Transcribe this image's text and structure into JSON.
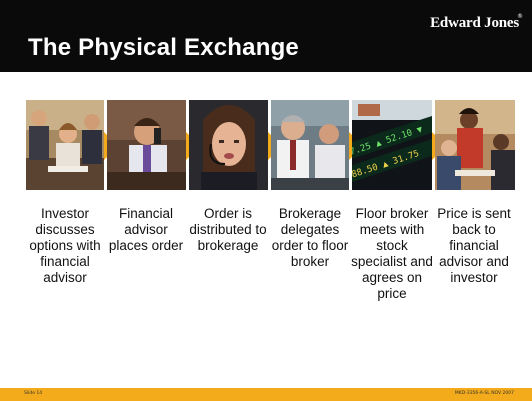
{
  "slide": {
    "title": "The Physical Exchange",
    "logo": "Edward Jones",
    "logo_mark": "®"
  },
  "steps": [
    {
      "caption": "Investor discusses options with financial advisor",
      "image": "meeting-photo"
    },
    {
      "caption": "Financial advisor places order",
      "image": "phone-call-photo"
    },
    {
      "caption": "Order is distributed to brokerage",
      "image": "headset-operator-photo"
    },
    {
      "caption": "Brokerage delegates order to floor broker",
      "image": "brokers-photo"
    },
    {
      "caption": "Floor broker meets with stock specialist and agrees on price",
      "image": "stock-ticker-photo"
    },
    {
      "caption": "Price is sent back to financial advisor and investor",
      "image": "advisor-investor-photo"
    }
  ],
  "footer": {
    "slide_number": "Slide 14",
    "doc_code": "MKD-3356-A-SL   NOV 2007"
  },
  "colors": {
    "header": "#0a0a0a",
    "accent": "#f3ab1b",
    "text": "#111111"
  }
}
